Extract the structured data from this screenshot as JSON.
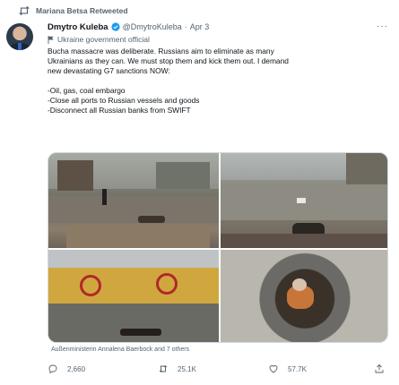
{
  "retweeted_by": "Mariana Betsa Retweeted",
  "tweet": {
    "author_name": "Dmytro Kuleba",
    "handle": "@DmytroKuleba",
    "separator": "·",
    "date": "Apr 3",
    "label": "Ukraine government official",
    "text_lines": [
      "Bucha massacre was deliberate. Russians aim to eliminate as many",
      "Ukrainians as they can. We must stop them and kick them out. I demand",
      "new devastating G7 sanctions NOW:",
      "",
      "-Oil, gas, coal embargo",
      "-Close all ports to Russian vessels and goods",
      "-Disconnect all Russian banks from SWIFT"
    ],
    "liked_by": "Außenministerin Annalena Baerbock and 7 others",
    "more_label": "···"
  },
  "actions": {
    "replies": "2,660",
    "retweets": "25.1K",
    "likes": "57.7K"
  },
  "colors": {
    "text": "#0f1419",
    "secondary": "#536471",
    "verified": "#1d9bf0"
  },
  "icons": [
    "retweet-icon",
    "verified-icon",
    "flag-icon",
    "more-icon",
    "reply-icon",
    "retweet-icon",
    "like-icon",
    "share-icon"
  ]
}
